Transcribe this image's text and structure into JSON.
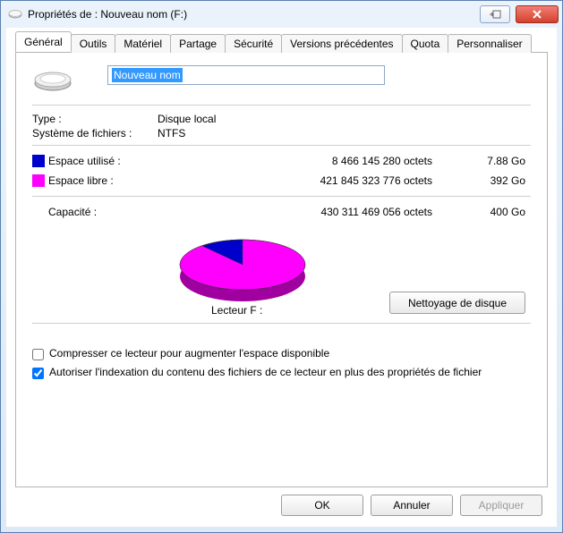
{
  "window": {
    "title": "Propriétés de : Nouveau nom (F:)"
  },
  "tabs": [
    {
      "label": "Général"
    },
    {
      "label": "Outils"
    },
    {
      "label": "Matériel"
    },
    {
      "label": "Partage"
    },
    {
      "label": "Sécurité"
    },
    {
      "label": "Versions précédentes"
    },
    {
      "label": "Quota"
    },
    {
      "label": "Personnaliser"
    }
  ],
  "drive": {
    "name": "Nouveau nom",
    "type_label": "Type :",
    "type_value": "Disque local",
    "fs_label": "Système de fichiers :",
    "fs_value": "NTFS"
  },
  "space": {
    "used_label": "Espace utilisé :",
    "used_bytes": "8 466 145 280 octets",
    "used_gb": "7.88 Go",
    "free_label": "Espace libre :",
    "free_bytes": "421 845 323 776 octets",
    "free_gb": "392 Go",
    "cap_label": "Capacité :",
    "cap_bytes": "430 311 469 056 octets",
    "cap_gb": "400 Go"
  },
  "drive_label": "Lecteur F :",
  "cleanup_button": "Nettoyage de disque",
  "checks": {
    "compress": "Compresser ce lecteur pour augmenter l'espace disponible",
    "index": "Autoriser l'indexation du contenu des fichiers de ce lecteur en plus des propriétés de fichier"
  },
  "buttons": {
    "ok": "OK",
    "cancel": "Annuler",
    "apply": "Appliquer"
  },
  "chart_data": {
    "type": "pie",
    "title": "Lecteur F :",
    "series": [
      {
        "name": "Espace utilisé",
        "value": 8466145280,
        "color": "#0000cc"
      },
      {
        "name": "Espace libre",
        "value": 421845323776,
        "color": "#ff00ff"
      }
    ]
  }
}
